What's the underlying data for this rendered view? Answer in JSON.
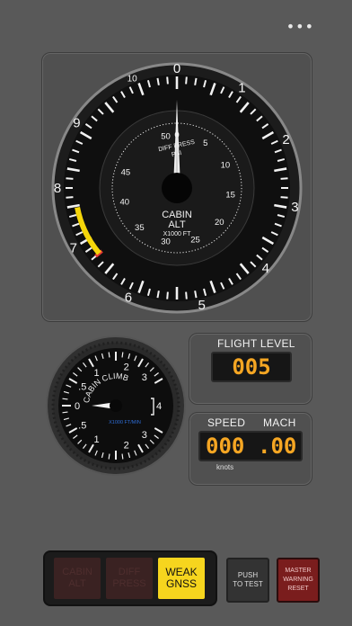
{
  "menu": {
    "more_label": "•••"
  },
  "altimeter": {
    "outer_scale_title": "DIFF PRESS",
    "outer_scale_unit": "PSI",
    "outer_ticks": [
      "10",
      "0",
      "1",
      "2",
      "3",
      "4",
      "5",
      "6",
      "7",
      "8",
      "9"
    ],
    "inner_ticks": [
      "50",
      "0",
      "5",
      "10",
      "15",
      "20",
      "25",
      "30",
      "35",
      "40",
      "45"
    ],
    "center_title": "CABIN",
    "center_subtitle": "ALT",
    "center_unit": "X1000 FT",
    "diff_press_value": 0,
    "cabin_alt_value": 0,
    "colors": {
      "redline": "#e53935",
      "caution": "#f5d60a",
      "needle": "#f2f2f2"
    }
  },
  "climb": {
    "title": "CABIN CLIMB",
    "unit": "X1000 FT/MIN",
    "left_labels": [
      "1",
      ".5",
      "0",
      ".5",
      "1"
    ],
    "right_labels": [
      "2",
      "3",
      "4",
      "3",
      "2"
    ],
    "value": 0
  },
  "flight_level": {
    "label": "FLIGHT LEVEL",
    "value": "005"
  },
  "speed": {
    "speed_label": "SPEED",
    "mach_label": "MACH",
    "speed_value": "000",
    "mach_value": ".00",
    "unit": "knots"
  },
  "annunciators": [
    {
      "line1": "CABIN",
      "line2": "ALT",
      "active": false
    },
    {
      "line1": "DIFF",
      "line2": "PRESS",
      "active": false
    },
    {
      "line1": "WEAK",
      "line2": "GNSS",
      "active": true
    }
  ],
  "buttons": {
    "push_to_test": {
      "line1": "PUSH",
      "line2": "TO TEST"
    },
    "master_warning": {
      "line1": "MASTER",
      "line2": "WARNING",
      "line3": "RESET"
    }
  }
}
